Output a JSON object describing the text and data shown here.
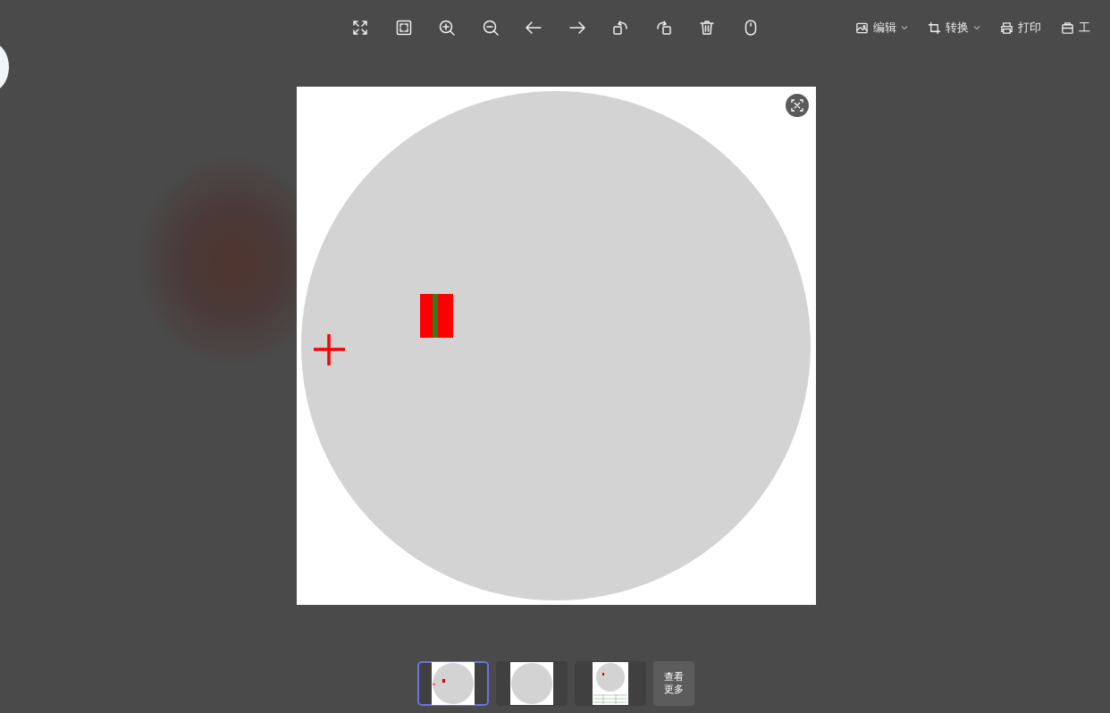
{
  "menu": [
    {
      "label": "编辑",
      "kind": "dropdown"
    },
    {
      "label": "转换",
      "kind": "dropdown"
    },
    {
      "label": "打印",
      "kind": "print"
    },
    {
      "label": "工",
      "kind": "tools"
    }
  ],
  "thumbnails": [
    {
      "kind": "circle-with-marks",
      "selected": true
    },
    {
      "kind": "plain-circle",
      "selected": false
    },
    {
      "kind": "circle-with-table",
      "selected": false
    }
  ],
  "more_button": {
    "label": "查看更多"
  }
}
